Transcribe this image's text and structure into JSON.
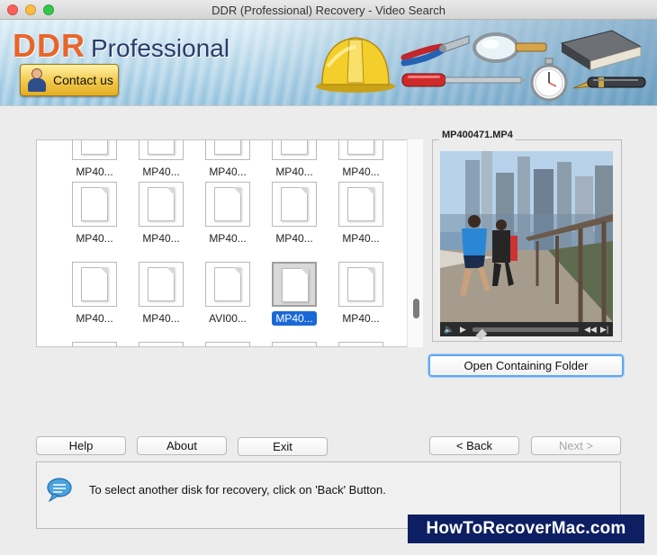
{
  "window": {
    "title": "DDR (Professional) Recovery - Video Search"
  },
  "banner": {
    "logo_ddr": "DDR",
    "logo_professional": "Professional",
    "contact_label": "Contact us"
  },
  "files": [
    {
      "name": "MP40...",
      "selected": false
    },
    {
      "name": "MP40...",
      "selected": false
    },
    {
      "name": "MP40...",
      "selected": false
    },
    {
      "name": "MP40...",
      "selected": false
    },
    {
      "name": "MP40...",
      "selected": false
    },
    {
      "name": "MP40...",
      "selected": false
    },
    {
      "name": "MP40...",
      "selected": false
    },
    {
      "name": "MP40...",
      "selected": false
    },
    {
      "name": "MP40...",
      "selected": false
    },
    {
      "name": "MP40...",
      "selected": false
    },
    {
      "name": "MP40...",
      "selected": false
    },
    {
      "name": "MP40...",
      "selected": false
    },
    {
      "name": "AVI00...",
      "selected": false
    },
    {
      "name": "MP40...",
      "selected": true
    },
    {
      "name": "MP40...",
      "selected": false
    }
  ],
  "preview": {
    "filename": "MP400471.MP4",
    "playback_fraction": 0.05
  },
  "buttons": {
    "open_folder": "Open Containing Folder",
    "help": "Help",
    "about": "About",
    "exit": "Exit",
    "back": "< Back",
    "next": "Next >"
  },
  "status": {
    "message": "To select another disk for recovery, click on 'Back' Button."
  },
  "watermark": "HowToRecoverMac.com",
  "colors": {
    "selection": "#1a68d6",
    "logo_orange": "#e8662b",
    "focus_ring": "#5fa8f1",
    "watermark_bg": "#0d1f62"
  }
}
